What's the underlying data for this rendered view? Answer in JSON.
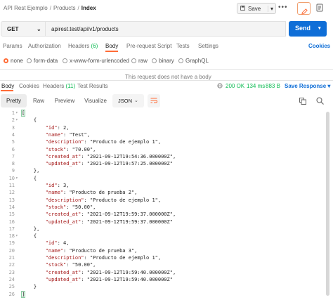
{
  "breadcrumb": {
    "items": [
      "API Rest Ejemplo",
      "Products"
    ],
    "current": "Index",
    "separator": "/"
  },
  "toolbar": {
    "save_label": "Save",
    "more_label": "•••"
  },
  "request": {
    "method": "GET",
    "url": "apirest.test/api/v1/products",
    "send_label": "Send"
  },
  "request_tabs": [
    {
      "label": "Params"
    },
    {
      "label": "Authorization"
    },
    {
      "label": "Headers",
      "count": "(6)"
    },
    {
      "label": "Body"
    },
    {
      "label": "Pre-request Script"
    },
    {
      "label": "Tests"
    },
    {
      "label": "Settings"
    }
  ],
  "cookies_label": "Cookies",
  "body_types": [
    "none",
    "form-data",
    "x-www-form-urlencoded",
    "raw",
    "binary",
    "GraphQL"
  ],
  "body_selected": "none",
  "no_body_message": "This request does not have a body",
  "response_tabs": [
    {
      "label": "Body"
    },
    {
      "label": "Cookies"
    },
    {
      "label": "Headers",
      "count": "(11)"
    },
    {
      "label": "Test Results"
    }
  ],
  "response_meta": {
    "status": "200 OK",
    "time": "134 ms",
    "size": "883 B",
    "save_label": "Save Response"
  },
  "view_modes": [
    "Pretty",
    "Raw",
    "Preview",
    "Visualize"
  ],
  "active_view": "Pretty",
  "format": "JSON",
  "code_lines": [
    "[",
    "    {",
    "        \"id\": 2,",
    "        \"name\": \"Test\",",
    "        \"description\": \"Producto de ejemplo 1\",",
    "        \"stock\": \"70.00\",",
    "        \"created_at\": \"2021-09-12T19:54:36.000000Z\",",
    "        \"updated_at\": \"2021-09-12T19:57:25.000000Z\"",
    "    },",
    "    {",
    "        \"id\": 3,",
    "        \"name\": \"Producto de prueba 2\",",
    "        \"description\": \"Producto de ejemplo 1\",",
    "        \"stock\": \"50.00\",",
    "        \"created_at\": \"2021-09-12T19:59:37.000000Z\",",
    "        \"updated_at\": \"2021-09-12T19:59:37.000000Z\"",
    "    },",
    "    {",
    "        \"id\": 4,",
    "        \"name\": \"Producto de prueba 3\",",
    "        \"description\": \"Producto de ejemplo 1\",",
    "        \"stock\": \"50.00\",",
    "        \"created_at\": \"2021-09-12T19:59:40.000000Z\",",
    "        \"updated_at\": \"2021-09-12T19:59:40.000000Z\"",
    "    }",
    "]"
  ],
  "colors": {
    "accent": "#ff6c37",
    "send": "#0f6ed7",
    "status_ok": "#0cbb52"
  }
}
